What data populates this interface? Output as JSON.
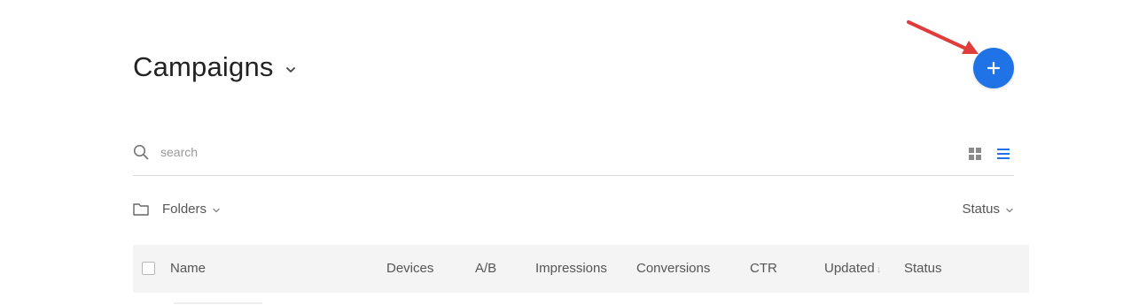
{
  "header": {
    "title": "Campaigns",
    "add_button_label": "+",
    "accent_color": "#1f73e6",
    "annotation_arrow_color": "#e03c3c"
  },
  "search": {
    "placeholder": "search",
    "value": ""
  },
  "view_toggle": {
    "grid_icon": "grid-view-icon",
    "list_icon": "list-view-icon",
    "active": "list"
  },
  "filters": {
    "folders_label": "Folders",
    "status_label": "Status"
  },
  "table": {
    "columns": [
      "Name",
      "Devices",
      "A/B",
      "Impressions",
      "Conversions",
      "CTR",
      "Updated",
      "Status"
    ],
    "sort_indicator": "↓"
  }
}
